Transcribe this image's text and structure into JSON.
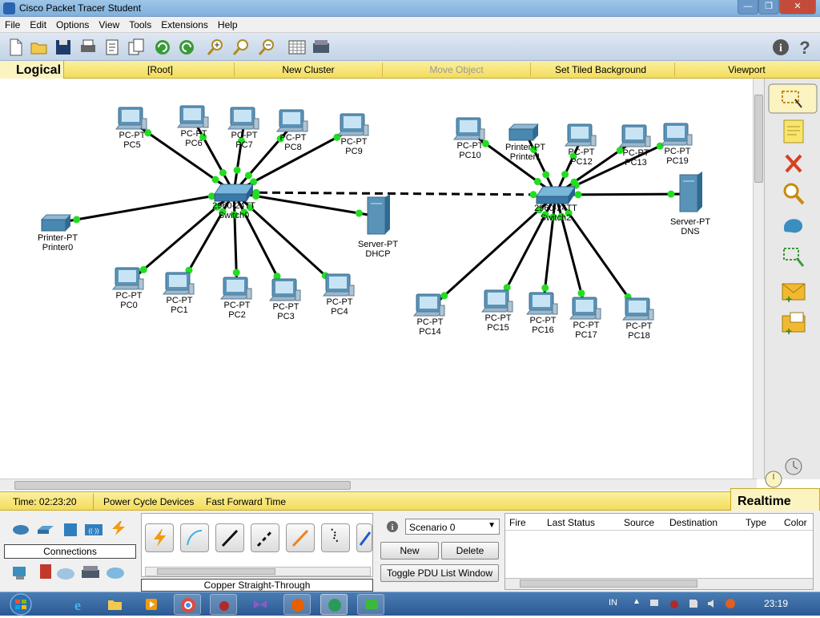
{
  "window": {
    "title": "Cisco Packet Tracer Student"
  },
  "menu": [
    "File",
    "Edit",
    "Options",
    "View",
    "Tools",
    "Extensions",
    "Help"
  ],
  "nav": {
    "logical": "Logical",
    "root": "[Root]",
    "new_cluster": "New Cluster",
    "move_object": "Move Object",
    "set_tiled_background": "Set Tiled Background",
    "viewport": "Viewport"
  },
  "status": {
    "time": "Time: 02:23:20",
    "power_cycle": "Power Cycle Devices",
    "fast_forward": "Fast Forward Time",
    "realtime": "Realtime"
  },
  "devices_panel": {
    "category_label": "Connections",
    "selected_connection": "Copper Straight-Through"
  },
  "scenario": {
    "selected": "Scenario 0",
    "new": "New",
    "delete": "Delete",
    "toggle": "Toggle PDU List Window"
  },
  "pdu_table": {
    "headers": [
      "Fire",
      "Last Status",
      "Source",
      "Destination",
      "Type",
      "Color"
    ]
  },
  "taskbar": {
    "language": "IN",
    "clock": "23:19"
  },
  "colors": {
    "link_light": "#22dd22",
    "toolbar": "#c3d3e6",
    "nav_yellow": "#f3dc5a"
  },
  "topology": {
    "devices": [
      {
        "id": "switch0",
        "model": "2960-24TT",
        "name": "Switch0",
        "kind": "switch"
      },
      {
        "id": "switch2",
        "model": "2960-24TT",
        "name": "Switch2",
        "kind": "switch"
      },
      {
        "id": "pc5",
        "model": "PC-PT",
        "name": "PC5",
        "kind": "pc"
      },
      {
        "id": "pc6",
        "model": "PC-PT",
        "name": "PC6",
        "kind": "pc"
      },
      {
        "id": "pc7",
        "model": "PC-PT",
        "name": "PC7",
        "kind": "pc"
      },
      {
        "id": "pc8",
        "model": "PC-PT",
        "name": "PC8",
        "kind": "pc"
      },
      {
        "id": "pc9",
        "model": "PC-PT",
        "name": "PC9",
        "kind": "pc"
      },
      {
        "id": "printer0",
        "model": "Printer-PT",
        "name": "Printer0",
        "kind": "printer"
      },
      {
        "id": "dhcp",
        "model": "Server-PT",
        "name": "DHCP",
        "kind": "server"
      },
      {
        "id": "pc0",
        "model": "PC-PT",
        "name": "PC0",
        "kind": "pc"
      },
      {
        "id": "pc1",
        "model": "PC-PT",
        "name": "PC1",
        "kind": "pc"
      },
      {
        "id": "pc2",
        "model": "PC-PT",
        "name": "PC2",
        "kind": "pc"
      },
      {
        "id": "pc3",
        "model": "PC-PT",
        "name": "PC3",
        "kind": "pc"
      },
      {
        "id": "pc4",
        "model": "PC-PT",
        "name": "PC4",
        "kind": "pc"
      },
      {
        "id": "pc10",
        "model": "PC-PT",
        "name": "PC10",
        "kind": "pc"
      },
      {
        "id": "printer1",
        "model": "Printer-PT",
        "name": "Printer1",
        "kind": "printer"
      },
      {
        "id": "pc12",
        "model": "PC-PT",
        "name": "PC12",
        "kind": "pc"
      },
      {
        "id": "pc13",
        "model": "PC-PT",
        "name": "PC13",
        "kind": "pc"
      },
      {
        "id": "pc19",
        "model": "PC-PT",
        "name": "PC19",
        "kind": "pc"
      },
      {
        "id": "dns",
        "model": "Server-PT",
        "name": "DNS",
        "kind": "server"
      },
      {
        "id": "pc14",
        "model": "PC-PT",
        "name": "PC14",
        "kind": "pc"
      },
      {
        "id": "pc15",
        "model": "PC-PT",
        "name": "PC15",
        "kind": "pc"
      },
      {
        "id": "pc16",
        "model": "PC-PT",
        "name": "PC16",
        "kind": "pc"
      },
      {
        "id": "pc17",
        "model": "PC-PT",
        "name": "PC17",
        "kind": "pc"
      },
      {
        "id": "pc18",
        "model": "PC-PT",
        "name": "PC18",
        "kind": "pc"
      }
    ],
    "links": [
      {
        "from": "switch0",
        "to": "pc5"
      },
      {
        "from": "switch0",
        "to": "pc6"
      },
      {
        "from": "switch0",
        "to": "pc7"
      },
      {
        "from": "switch0",
        "to": "pc8"
      },
      {
        "from": "switch0",
        "to": "pc9"
      },
      {
        "from": "switch0",
        "to": "printer0"
      },
      {
        "from": "switch0",
        "to": "dhcp"
      },
      {
        "from": "switch0",
        "to": "pc0"
      },
      {
        "from": "switch0",
        "to": "pc1"
      },
      {
        "from": "switch0",
        "to": "pc2"
      },
      {
        "from": "switch0",
        "to": "pc3"
      },
      {
        "from": "switch0",
        "to": "pc4"
      },
      {
        "from": "switch0",
        "to": "switch2",
        "style": "dashed"
      },
      {
        "from": "switch2",
        "to": "pc10"
      },
      {
        "from": "switch2",
        "to": "printer1"
      },
      {
        "from": "switch2",
        "to": "pc12"
      },
      {
        "from": "switch2",
        "to": "pc13"
      },
      {
        "from": "switch2",
        "to": "pc19"
      },
      {
        "from": "switch2",
        "to": "dns"
      },
      {
        "from": "switch2",
        "to": "pc14"
      },
      {
        "from": "switch2",
        "to": "pc15"
      },
      {
        "from": "switch2",
        "to": "pc16"
      },
      {
        "from": "switch2",
        "to": "pc17"
      },
      {
        "from": "switch2",
        "to": "pc18"
      }
    ]
  }
}
